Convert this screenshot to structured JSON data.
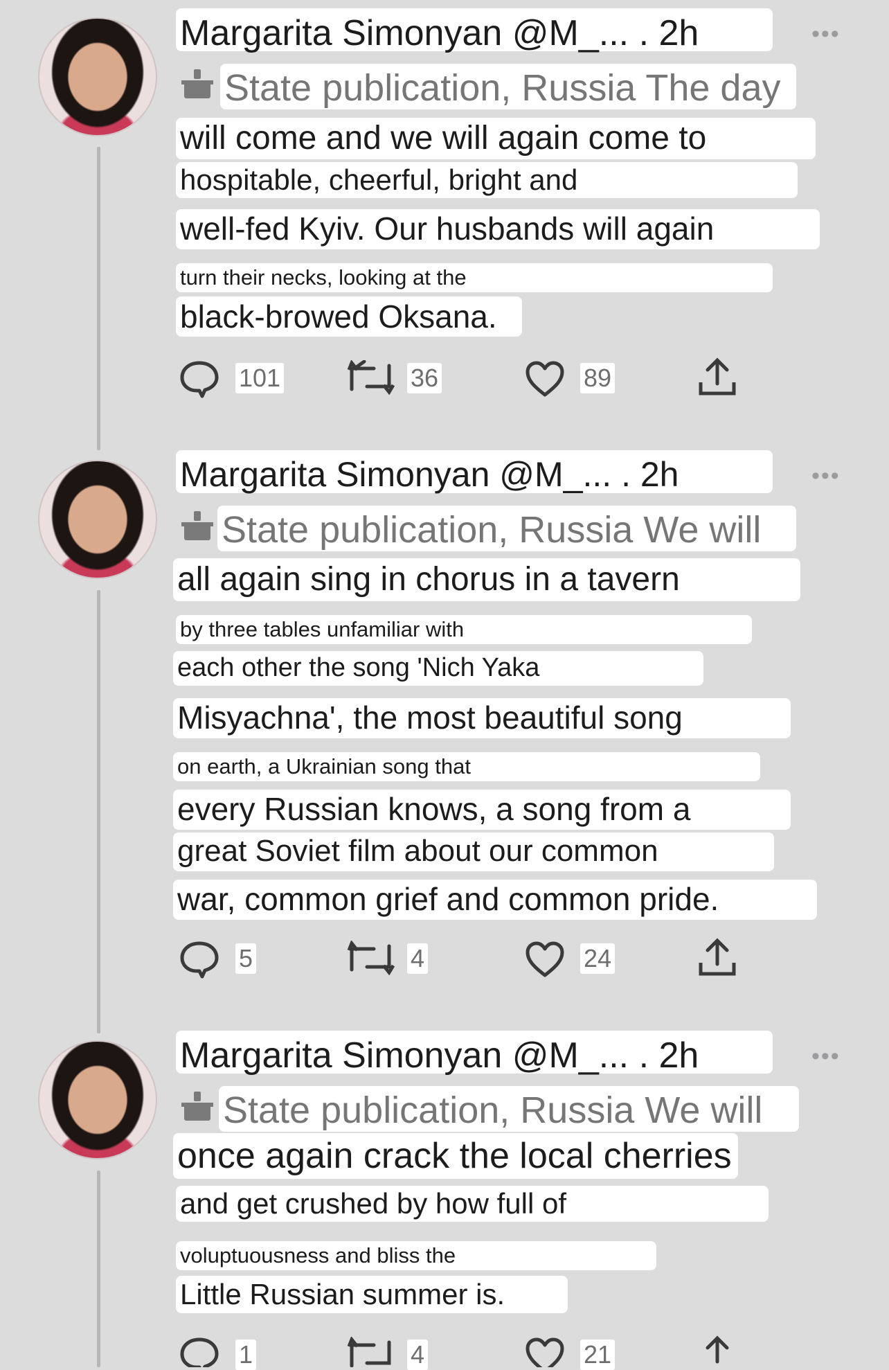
{
  "tweets": [
    {
      "header": "Margarita Simonyan @M_... . 2h",
      "line1_label": "State publication, Russia",
      "line1_rest": "The day",
      "lines": [
        "will come and we will again come to",
        "hospitable, cheerful, bright and",
        "well-fed Kyiv. Our husbands will again",
        "turn their necks, looking at the",
        "black-browed Oksana."
      ],
      "replies": "101",
      "retweets": "36",
      "likes": "89"
    },
    {
      "header": "Margarita Simonyan @M_... . 2h",
      "line1_label": "State publication, Russia",
      "line1_rest": "We will",
      "lines": [
        "all again sing in chorus in a tavern",
        "by three tables unfamiliar with",
        "each other the song 'Nich Yaka",
        "Misyachna', the most beautiful song",
        "on earth, a Ukrainian song that",
        "every Russian knows, a song from a",
        "great Soviet film about our common",
        "war, common grief and common pride."
      ],
      "replies": "5",
      "retweets": "4",
      "likes": "24"
    },
    {
      "header": "Margarita Simonyan @M_... . 2h",
      "line1_label": "State publication, Russia",
      "line1_rest": "We will",
      "lines": [
        "once again crack the local cherries",
        "and get crushed by how full of",
        "voluptuousness and bliss the",
        "Little Russian summer is."
      ],
      "replies": "1",
      "retweets": "4",
      "likes": "21"
    }
  ],
  "icons": {
    "reply": "speech-bubble-icon",
    "retweet": "retweet-arrows-icon",
    "like": "heart-icon",
    "share": "share-upload-icon",
    "more": "ellipsis-icon",
    "publication": "podium-icon"
  }
}
